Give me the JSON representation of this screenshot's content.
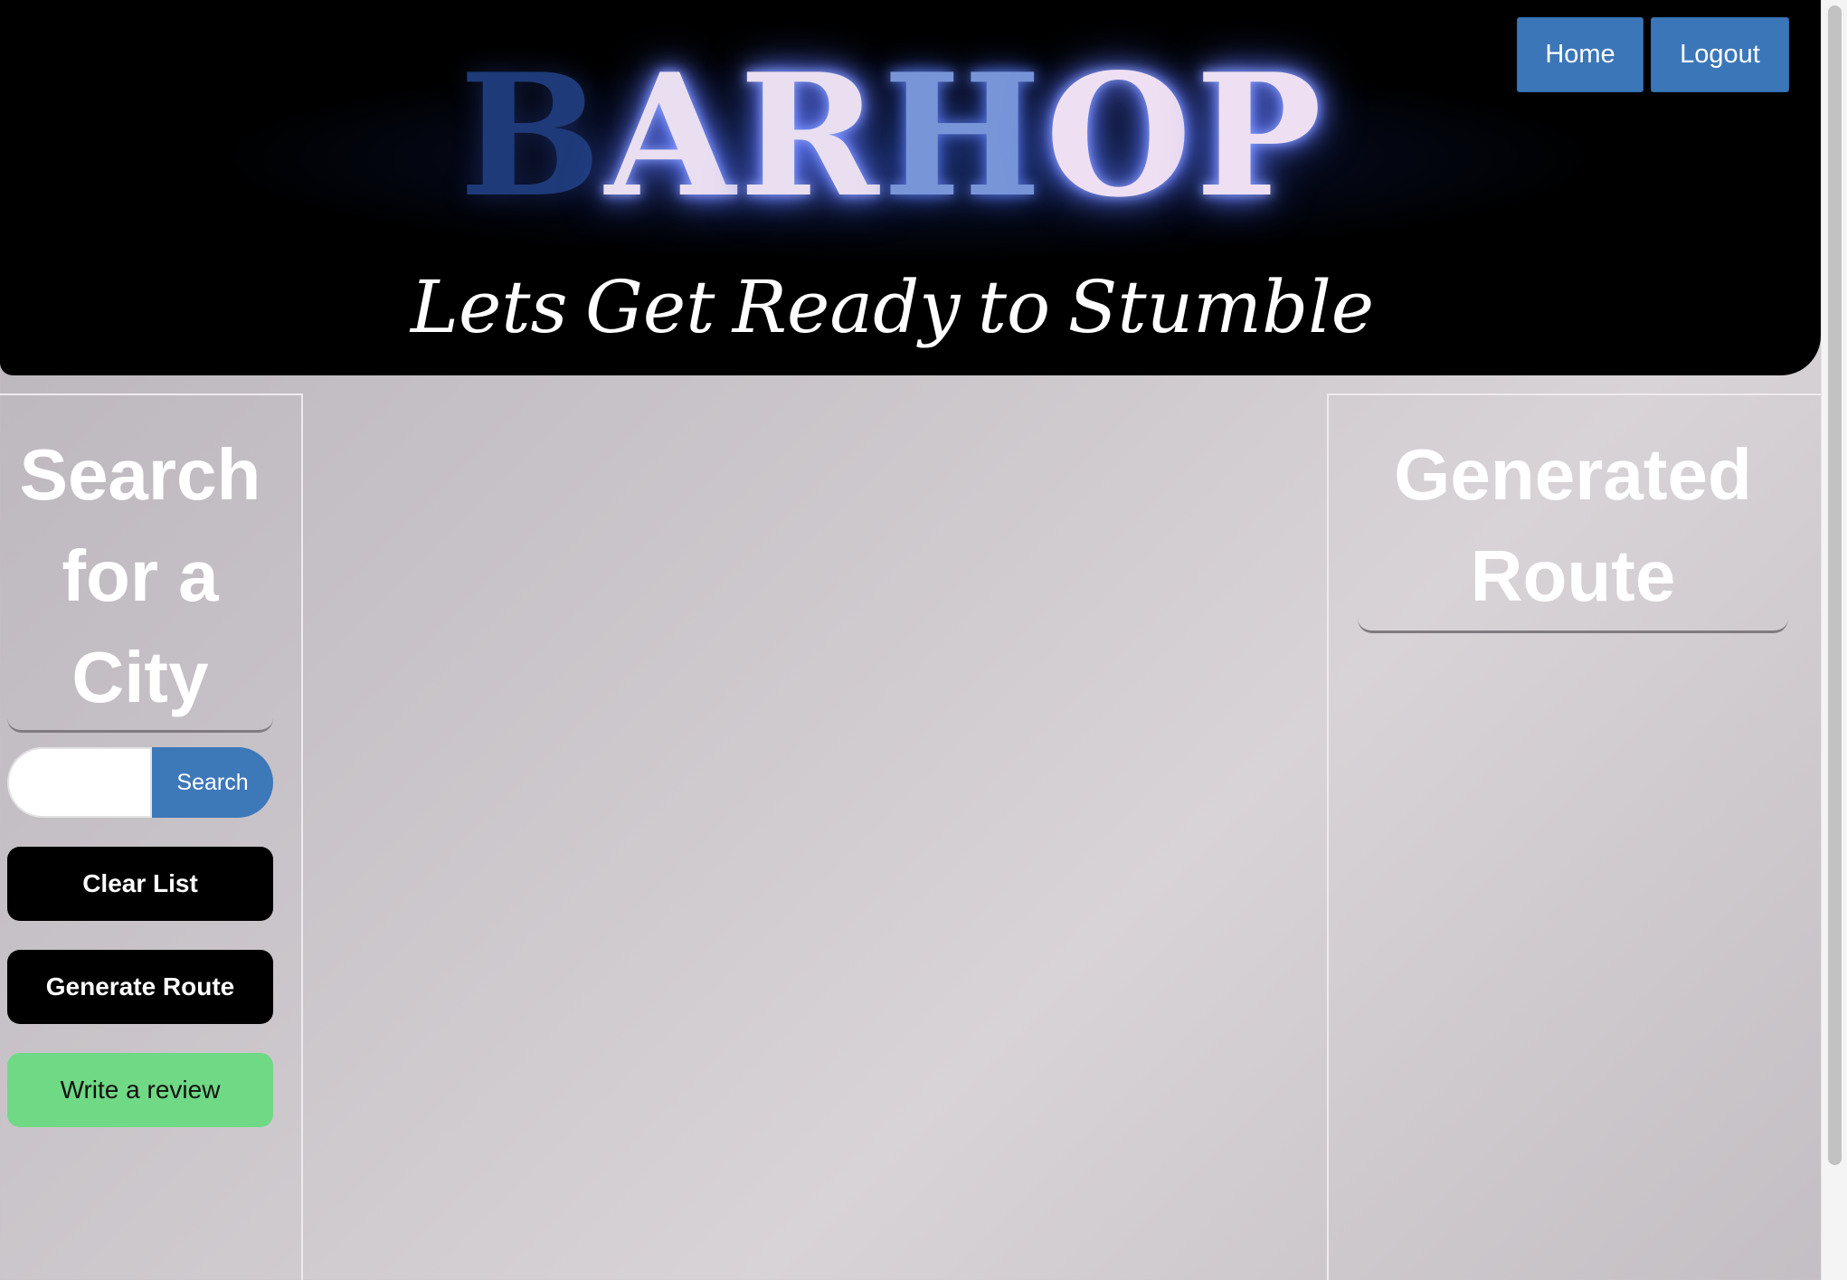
{
  "header": {
    "logo_letters": [
      "B",
      "A",
      "R",
      "H",
      "O",
      "P"
    ],
    "tagline": "Lets Get Ready to Stumble",
    "nav": {
      "home_label": "Home",
      "logout_label": "Logout"
    }
  },
  "sidebar": {
    "title": "Search for a City",
    "search": {
      "value": "",
      "placeholder": "",
      "button_label": "Search"
    },
    "clear_label": "Clear List",
    "generate_label": "Generate Route",
    "review_label": "Write a review"
  },
  "route_panel": {
    "title": "Generated Route"
  },
  "colors": {
    "nav_button": "#3b76b8",
    "search_button": "#3d78b9",
    "review_button": "#6fd985",
    "header_bg": "#000000"
  }
}
